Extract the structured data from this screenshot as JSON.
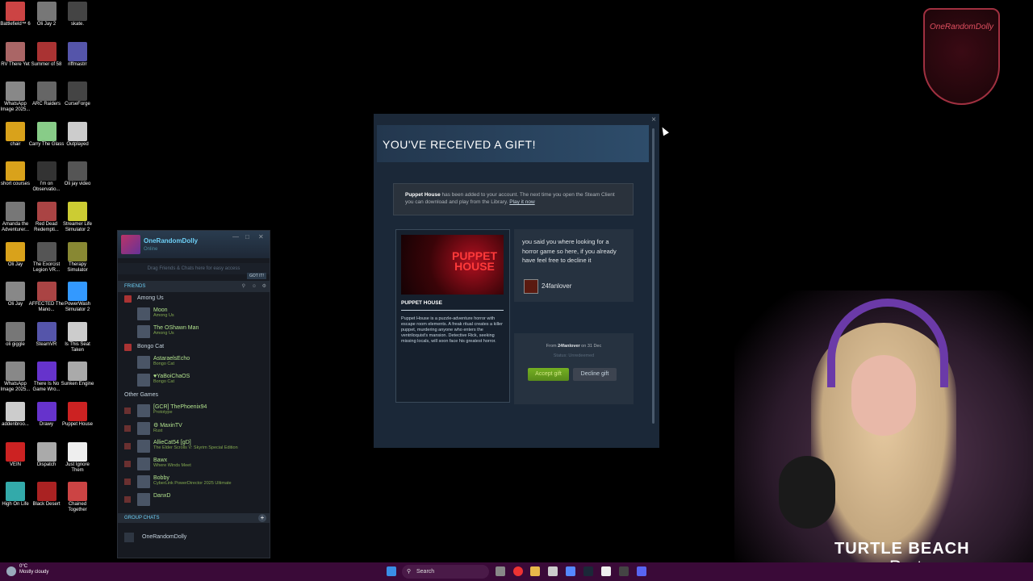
{
  "desktop": {
    "icons": [
      {
        "label": "Battlefield™ 6"
      },
      {
        "label": "Oli Jay 2"
      },
      {
        "label": "skate."
      },
      {
        "label": "RV There Yet"
      },
      {
        "label": "Summer of 58"
      },
      {
        "label": "riffmastrr"
      },
      {
        "label": "WhatsApp Image 2025..."
      },
      {
        "label": "ARC Raiders"
      },
      {
        "label": "CurseForge"
      },
      {
        "label": "chair"
      },
      {
        "label": "Carry The Glass"
      },
      {
        "label": "Outplayed"
      },
      {
        "label": "short courses"
      },
      {
        "label": "I'm on Observatio..."
      },
      {
        "label": "Oli jay video"
      },
      {
        "label": "Amanda the Adventurer..."
      },
      {
        "label": "Red Dead Redempti..."
      },
      {
        "label": "Streamer Life Simulator 2"
      },
      {
        "label": "Oli Jay"
      },
      {
        "label": "The Exorcist Legion VR..."
      },
      {
        "label": "Therapy Simulator"
      },
      {
        "label": "Oli Jay"
      },
      {
        "label": "AFFECTED The Mano..."
      },
      {
        "label": "PowerWash Simulator 2"
      },
      {
        "label": "oli giggle"
      },
      {
        "label": "SteamVR"
      },
      {
        "label": "Is This Seat Taken"
      },
      {
        "label": "WhatsApp Image 2025..."
      },
      {
        "label": "There Is No Game Wro..."
      },
      {
        "label": "Sunken Engine"
      },
      {
        "label": "addenbroo..."
      },
      {
        "label": "Drawy"
      },
      {
        "label": "Puppet House"
      },
      {
        "label": "VEIN"
      },
      {
        "label": "Dispatch"
      },
      {
        "label": "Just Ignore Them"
      },
      {
        "label": "High On Life"
      },
      {
        "label": "Black Desert"
      },
      {
        "label": "Chained Together"
      }
    ]
  },
  "friends": {
    "username": "OneRandomDolly",
    "status": "Online",
    "drag_hint": "Drag Friends & Chats here for easy access",
    "got_it": "GOT IT!",
    "friends_header": "FRIENDS",
    "groups": [
      {
        "name": "Among Us",
        "members": [
          {
            "name": "Moon",
            "game": "Among Us"
          },
          {
            "name": "The OShawn Man",
            "game": "Among Us"
          }
        ]
      },
      {
        "name": "Bongo Cat",
        "members": [
          {
            "name": "AstaraelsEcho",
            "game": "Bongo Cat"
          },
          {
            "name": "♥YaBoiChaOS",
            "game": "Bongo Cat"
          }
        ]
      }
    ],
    "other_games_label": "Other Games",
    "others": [
      {
        "name": "[GCR] ThePhoenix94",
        "game": "Prototype"
      },
      {
        "name": "⚙ MaxinTV",
        "game": "Rust"
      },
      {
        "name": "AllieCat54 [gD]",
        "game": "The Elder Scrolls V: Skyrim Special Edition"
      },
      {
        "name": "Bawx",
        "game": "Where Winds Meet"
      },
      {
        "name": "Bobby",
        "game": "CyberLink PowerDirector 2025 Ultimate"
      },
      {
        "name": "DanxD",
        "game": ""
      }
    ],
    "group_chats_label": "GROUP CHATS",
    "group_chat": "OneRandomDolly"
  },
  "gift": {
    "title": "YOU'VE RECEIVED A GIFT!",
    "notice_game": "Puppet House",
    "notice_text": " has been added to your account. The next time you open the Steam Client you can download and play from the Library. ",
    "notice_link": "Play it now",
    "game_name": "PUPPET HOUSE",
    "art_logo": "PUPPET HOUSE",
    "game_desc": "Puppet House is a puzzle-adventure horror with escape room elements. A freak ritual creates a killer puppet, murdering anyone who enters the ventriloquist's mansion. Detective Rick, seeking missing locals, will soon face his greatest horror.",
    "message": "you said you where looking for a horror game so here, if you already have feel free to decline it",
    "sender": "24fanlover",
    "from_prefix": "From ",
    "from_name": "24fanlover",
    "from_suffix": " on 31 Dec",
    "status": "Status: Unredeemed",
    "accept_label": "Accept gift",
    "decline_label": "Decline gift"
  },
  "overlay": {
    "crest_text": "OneRandomDolly",
    "brand": "TURTLE BEACH",
    "partner": "Partner"
  },
  "taskbar": {
    "temp": "0°C",
    "weather": "Mostly cloudy",
    "search": "Search"
  }
}
